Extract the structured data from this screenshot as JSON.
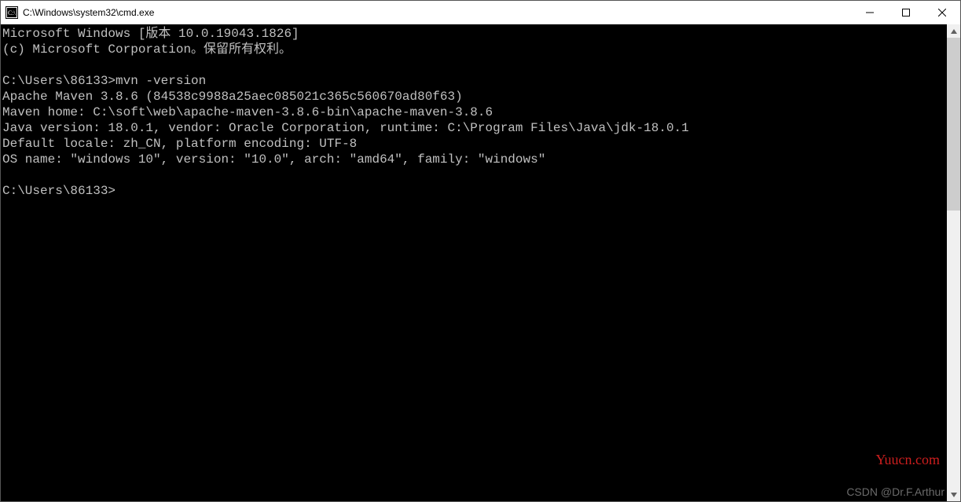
{
  "window": {
    "title": "C:\\Windows\\system32\\cmd.exe"
  },
  "terminal": {
    "lines": [
      "Microsoft Windows [版本 10.0.19043.1826]",
      "(c) Microsoft Corporation。保留所有权利。",
      "",
      "C:\\Users\\86133>mvn -version",
      "Apache Maven 3.8.6 (84538c9988a25aec085021c365c560670ad80f63)",
      "Maven home: C:\\soft\\web\\apache-maven-3.8.6-bin\\apache-maven-3.8.6",
      "Java version: 18.0.1, vendor: Oracle Corporation, runtime: C:\\Program Files\\Java\\jdk-18.0.1",
      "Default locale: zh_CN, platform encoding: UTF-8",
      "OS name: \"windows 10\", version: \"10.0\", arch: \"amd64\", family: \"windows\"",
      "",
      "C:\\Users\\86133>"
    ]
  },
  "watermarks": {
    "site": "Yuucn.com",
    "author": "CSDN @Dr.F.Arthur"
  }
}
